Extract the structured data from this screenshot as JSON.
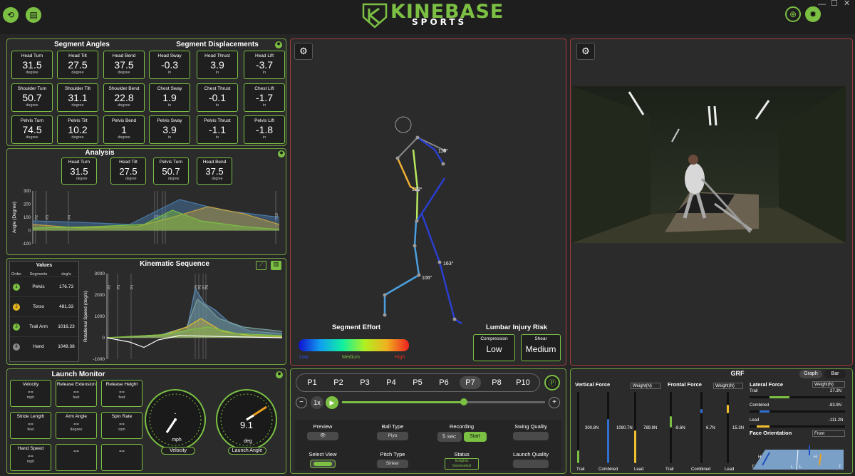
{
  "header": {
    "logo_word": "KINEBASE",
    "logo_sub": "SPORTS"
  },
  "segment_angles": {
    "title": "Segment Angles",
    "cards": [
      {
        "label": "Head Turn",
        "value": "31.5",
        "unit": "degree"
      },
      {
        "label": "Head Tilt",
        "value": "27.5",
        "unit": "degree"
      },
      {
        "label": "Head Bend",
        "value": "37.5",
        "unit": "degree"
      },
      {
        "label": "Shoulder Turn",
        "value": "50.7",
        "unit": "degree"
      },
      {
        "label": "Shoulder Tilt",
        "value": "31.1",
        "unit": "degree"
      },
      {
        "label": "Shoulder Bend",
        "value": "22.8",
        "unit": "degree"
      },
      {
        "label": "Pelvis Turn",
        "value": "74.5",
        "unit": "degree"
      },
      {
        "label": "Pelvis Tilt",
        "value": "10.2",
        "unit": "degree"
      },
      {
        "label": "Pelvis Bend",
        "value": "1",
        "unit": "degree"
      }
    ]
  },
  "segment_displacements": {
    "title": "Segment Displacements",
    "cards": [
      {
        "label": "Head Sway",
        "value": "-0.3",
        "unit": "in"
      },
      {
        "label": "Head Thrust",
        "value": "3.9",
        "unit": "in"
      },
      {
        "label": "Head Lift",
        "value": "-3.7",
        "unit": "in"
      },
      {
        "label": "Chest Sway",
        "value": "1.9",
        "unit": "in"
      },
      {
        "label": "Chest Thrust",
        "value": "-0.1",
        "unit": "in"
      },
      {
        "label": "Chest Lift",
        "value": "-1.7",
        "unit": "in"
      },
      {
        "label": "Pelvis Sway",
        "value": "3.9",
        "unit": "in"
      },
      {
        "label": "Pelvis Thrust",
        "value": "-1.1",
        "unit": "in"
      },
      {
        "label": "Pelvis Lift",
        "value": "-1.8",
        "unit": "in"
      }
    ]
  },
  "analysis": {
    "title": "Analysis",
    "cards": [
      {
        "label": "Head Turn",
        "value": "31.5",
        "unit": "degree"
      },
      {
        "label": "Head Tilt",
        "value": "27.5",
        "unit": "degree"
      },
      {
        "label": "Pelvis Turn",
        "value": "50.7",
        "unit": "degree"
      },
      {
        "label": "Head Bend",
        "value": "37.5",
        "unit": "degree"
      }
    ],
    "chart_data": {
      "type": "line",
      "ylabel": "Angle (Degree)",
      "ylim": [
        -100,
        300
      ],
      "yticks": [
        "300",
        "200",
        "100",
        "0",
        "-100"
      ],
      "markers": [
        "P2",
        "P3",
        "P4",
        "P5",
        "P6",
        "P7",
        "P8",
        "P10"
      ]
    }
  },
  "kinematic": {
    "title": "Kinematic Sequence",
    "values_title": "Values",
    "headers": [
      "Order",
      "Segments",
      "deg/s"
    ],
    "rows": [
      {
        "order": "1",
        "segment": "Pelvis",
        "value": "176.73",
        "color": "#7bc043"
      },
      {
        "order": "2",
        "segment": "Torso",
        "value": "481.33",
        "color": "#e8b820"
      },
      {
        "order": "3",
        "segment": "Trail Arm",
        "value": "1016.23",
        "color": "#7bc043"
      },
      {
        "order": "4",
        "segment": "Hand",
        "value": "1049.38",
        "color": "#888888"
      }
    ],
    "chart_data": {
      "type": "line",
      "ylabel": "Rotational Speed (deg/s)",
      "ylim": [
        -1000,
        3000
      ],
      "yticks": [
        "3000",
        "2000",
        "1000",
        "0",
        "-1000"
      ],
      "markers": [
        "P2",
        "P3",
        "P4",
        "P5",
        "P6",
        "P7",
        "P8"
      ],
      "peaks": {
        "Pelvis": 176.73,
        "Torso": 481.33,
        "Trail Arm": 1016.23,
        "Hand": 1049.38
      }
    }
  },
  "launch_monitor": {
    "title": "Launch Monitor",
    "cards": [
      {
        "label": "Velocity",
        "value": "--",
        "unit": "mph"
      },
      {
        "label": "Release Extension",
        "value": "--",
        "unit": "feet"
      },
      {
        "label": "Release Height",
        "value": "--",
        "unit": "feet"
      },
      {
        "label": "Stride Length",
        "value": "--",
        "unit": "feet"
      },
      {
        "label": "Arm Angle",
        "value": "--",
        "unit": "degree"
      },
      {
        "label": "Spin Rate",
        "value": "--",
        "unit": "rpm"
      },
      {
        "label": "Hand Speed",
        "value": "--",
        "unit": "mph"
      },
      {
        "label": "",
        "value": "--",
        "unit": ""
      },
      {
        "label": "",
        "value": "--",
        "unit": ""
      }
    ],
    "gauge_velocity": {
      "value": "-",
      "unit": "mph",
      "label": "Velocity"
    },
    "gauge_angle": {
      "value": "9.1",
      "unit": "deg",
      "label": "Launch Angle"
    }
  },
  "skeleton": {
    "angles": [
      "116°",
      "120°",
      "163°",
      "106°"
    ],
    "effort_title": "Segment Effort",
    "effort_low": "Low",
    "effort_medium": "Medium",
    "effort_high": "High",
    "lumbar_title": "Lumbar Injury Risk",
    "compression_label": "Compression",
    "compression_value": "Low",
    "shear_label": "Shear",
    "shear_value": "Medium"
  },
  "playback": {
    "phases": [
      "P1",
      "P2",
      "P3",
      "P4",
      "P5",
      "P6",
      "P7",
      "P8",
      "P10"
    ],
    "active_phase": "P7",
    "speed": "1x",
    "progress": 0.6
  },
  "controls": {
    "preview": "Preview",
    "ball_type": "Ball Type",
    "ball_type_value": "Plyo",
    "recording": "Recording",
    "recording_time": "5 sec",
    "start": "Start",
    "swing_quality": "Swing Quality",
    "select_view": "Select View",
    "pitch_type": "Pitch Type",
    "pitch_type_value": "Sinker",
    "status": "Status",
    "status_value_1": "Insights",
    "status_value_2": "Generated",
    "launch_quality": "Launch Quality"
  },
  "grf": {
    "title": "GRF",
    "tab_graph": "Graph",
    "tab_bar": "Bar",
    "vertical": {
      "title": "Vertical Force",
      "unit": "Weight(N)",
      "trail": "300.8N",
      "combined": "1090.7N",
      "lead": "789.9N",
      "labels": [
        "Trail",
        "Combined",
        "Lead"
      ]
    },
    "frontal": {
      "title": "Frontal Force",
      "unit": "Weight(N)",
      "trail": "-8.6N",
      "combined": "6.7N",
      "lead": "15.3N",
      "labels": [
        "Trail",
        "Combined",
        "Lead"
      ]
    },
    "lateral": {
      "title": "Lateral Force",
      "unit": "Weight(N)",
      "trail_label": "Trail",
      "trail": "27.3N",
      "combined_label": "Combined",
      "combined": "-83.9N",
      "lead_label": "Lead",
      "lead": "-111.2N"
    },
    "face_title": "Face Orientation",
    "face_value": "Front"
  },
  "colors": {
    "accent": "#7bc043",
    "panel_border_red": "#a33b3b",
    "bg": "#262626"
  }
}
